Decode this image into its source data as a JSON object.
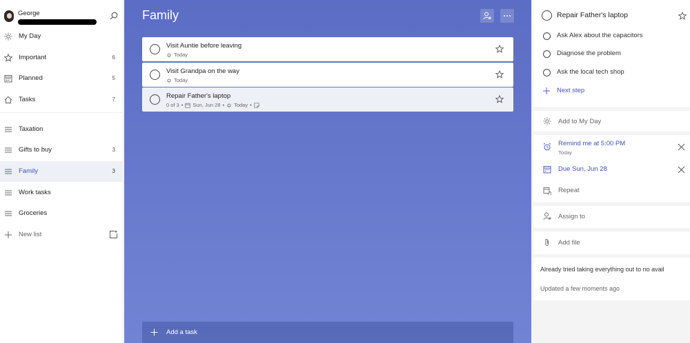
{
  "sidebar": {
    "user_name": "George",
    "items": [
      {
        "label": "My Day",
        "count": "",
        "icon": "sun-icon"
      },
      {
        "label": "Important",
        "count": "6",
        "icon": "star-icon"
      },
      {
        "label": "Planned",
        "count": "5",
        "icon": "calendar-icon"
      },
      {
        "label": "Tasks",
        "count": "7",
        "icon": "home-icon"
      }
    ],
    "lists": [
      {
        "label": "Taxation",
        "count": ""
      },
      {
        "label": "Gifts to buy",
        "count": "3"
      },
      {
        "label": "Family",
        "count": "3",
        "active": true
      },
      {
        "label": "Work tasks",
        "count": ""
      },
      {
        "label": "Groceries",
        "count": ""
      }
    ],
    "new_list_label": "New list"
  },
  "main": {
    "title": "Family",
    "tasks": [
      {
        "title": "Visit Auntie before leaving",
        "reminder": "Today"
      },
      {
        "title": "Visit Grandpa on the way",
        "reminder": "Today"
      },
      {
        "title": "Repair Father's laptop",
        "steps": "0 of 3",
        "due": "Sun, Jun 28",
        "reminder": "Today",
        "selected": true
      }
    ],
    "add_task_label": "Add a task",
    "accent_color": "#5b6dc4"
  },
  "detail": {
    "title": "Repair Father's laptop",
    "steps": [
      {
        "label": "Ask Alex about the capacitors"
      },
      {
        "label": "Diagnose the problem"
      },
      {
        "label": "Ask the local tech shop"
      }
    ],
    "next_step_label": "Next step",
    "add_to_my_day_label": "Add to My Day",
    "reminder_label": "Remind me at 5:00 PM",
    "reminder_sub": "Today",
    "due_label": "Due Sun, Jun 28",
    "repeat_label": "Repeat",
    "assign_label": "Assign to",
    "add_file_label": "Add file",
    "note": "Already tried taking everything out to no avail",
    "updated": "Updated a few moments ago"
  }
}
